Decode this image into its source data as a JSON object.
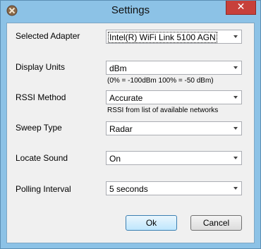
{
  "window": {
    "title": "Settings",
    "close_glyph": "✕"
  },
  "fields": {
    "adapter": {
      "label": "Selected Adapter",
      "value": "Intel(R) WiFi Link 5100 AGN"
    },
    "display_units": {
      "label": "Display Units",
      "value": "dBm",
      "note": "(0% = -100dBm 100% = -50 dBm)"
    },
    "rssi_method": {
      "label": "RSSI Method",
      "value": "Accurate",
      "note": "RSSI from list of available networks"
    },
    "sweep_type": {
      "label": "Sweep Type",
      "value": "Radar"
    },
    "locate_sound": {
      "label": "Locate Sound",
      "value": "On"
    },
    "polling_interval": {
      "label": "Polling Interval",
      "value": "5 seconds"
    }
  },
  "buttons": {
    "ok": "Ok",
    "cancel": "Cancel"
  },
  "icons": {
    "app": "settings-app-icon",
    "close": "close-icon",
    "dropdown": "chevron-down-icon"
  }
}
